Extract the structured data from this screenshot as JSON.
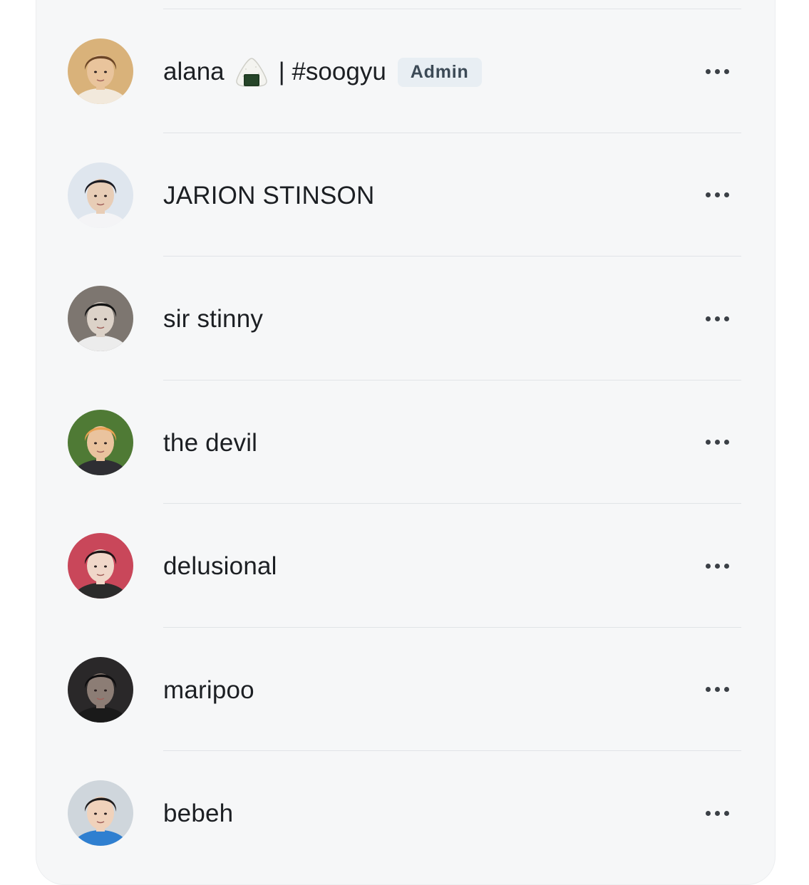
{
  "members": [
    {
      "name_prefix": "alana",
      "emoji": "🍙",
      "name_suffix": "| #soogyu",
      "badge": "Admin",
      "avatar": {
        "bg": "#d9b27a",
        "hair": "#6b4526",
        "skin": "#e9c49c",
        "shirt": "#f2e9dc"
      },
      "more_icon": "ellipsis-horizontal-icon"
    },
    {
      "name": "JARION STINSON",
      "avatar": {
        "bg": "#dfe6ee",
        "hair": "#1b1b22",
        "skin": "#e8cdb6",
        "shirt": "#f4f4f6"
      },
      "more_icon": "ellipsis-horizontal-icon"
    },
    {
      "name": "sir stinny",
      "avatar": {
        "bg": "#7d7670",
        "hair": "#141414",
        "skin": "#dcd2c8",
        "shirt": "#ececec"
      },
      "more_icon": "ellipsis-horizontal-icon"
    },
    {
      "name": "the devil",
      "avatar": {
        "bg": "#4f7a35",
        "hair": "#e9a254",
        "skin": "#eac39e",
        "shirt": "#2e2e33"
      },
      "more_icon": "ellipsis-horizontal-icon"
    },
    {
      "name": "delusional",
      "avatar": {
        "bg": "#c9475a",
        "hair": "#1d1416",
        "skin": "#f0d7c9",
        "shirt": "#2b2b2b"
      },
      "more_icon": "ellipsis-horizontal-icon"
    },
    {
      "name": "maripoo",
      "avatar": {
        "bg": "#2a2829",
        "hair": "#0e0d0e",
        "skin": "#8c7d75",
        "shirt": "#1a1a1a"
      },
      "more_icon": "ellipsis-horizontal-icon"
    },
    {
      "name": "bebeh",
      "avatar": {
        "bg": "#cfd6dc",
        "hair": "#1f1c1c",
        "skin": "#f0d2bb",
        "shirt": "#2f7fd0"
      },
      "more_icon": "ellipsis-horizontal-icon"
    }
  ]
}
